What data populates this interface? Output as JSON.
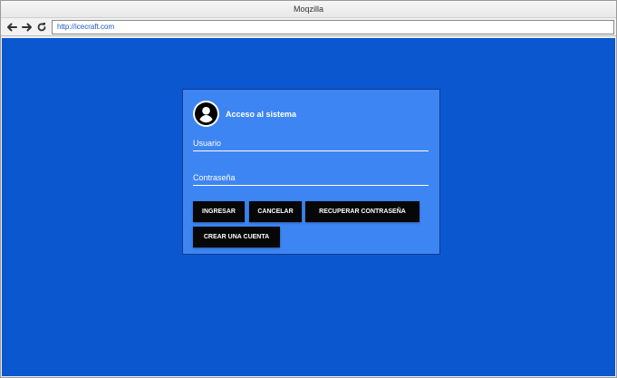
{
  "browser": {
    "title": "Moqzilla",
    "url": "http://icecraft.com",
    "icons": {
      "back": "arrow-left-icon",
      "forward": "arrow-right-icon",
      "reload": "reload-icon"
    }
  },
  "login": {
    "title": "Acceso al sistema",
    "avatar_icon": "user-circle-icon",
    "username_placeholder": "Usuario",
    "password_placeholder": "Contraseña",
    "buttons": {
      "ingresar": "INGRESAR",
      "cancelar": "CANCELAR",
      "recuperar": "RECUPERAR CONTRASEÑA",
      "crear": "CREAR UNA CUENTA"
    }
  },
  "colors": {
    "background": "#0b57d0",
    "card": "#3d85f2",
    "button": "#070707",
    "text": "#ffffff"
  }
}
